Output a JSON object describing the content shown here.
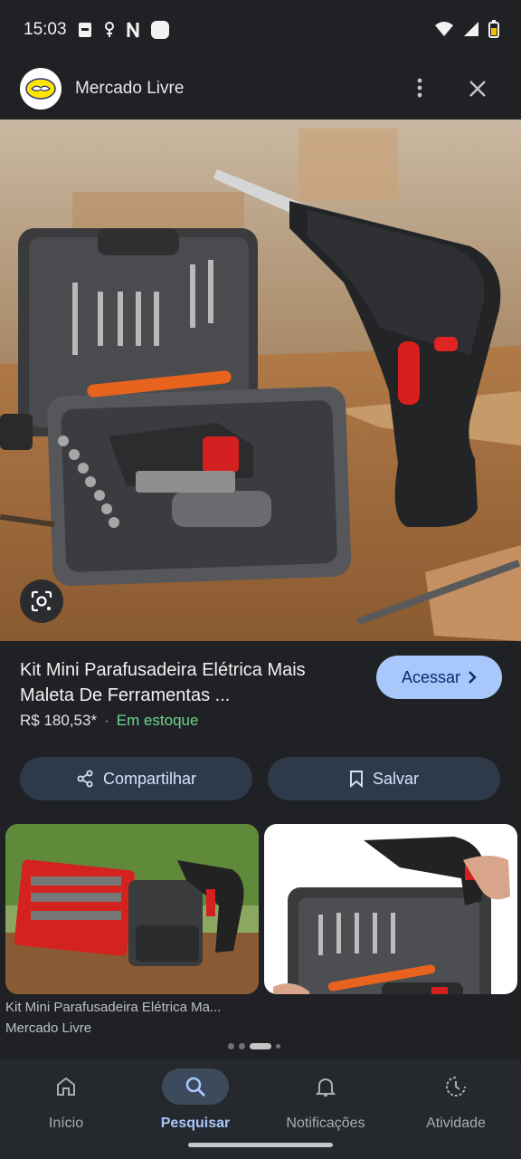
{
  "status_bar": {
    "time": "15:03"
  },
  "header": {
    "site_name": "Mercado Livre"
  },
  "product": {
    "title_line1": "Kit Mini Parafusadeira Elétrica Mais",
    "title_line2": "Maleta De Ferramentas ...",
    "price": "R$ 180,53*",
    "separator": "·",
    "stock": "Em estoque",
    "access_label": "Acessar"
  },
  "actions": {
    "share_label": "Compartilhar",
    "save_label": "Salvar"
  },
  "related": [
    {
      "title": "Kit Mini Parafusadeira Elétrica Ma...",
      "source": "Mercado Livre"
    },
    {
      "title": "",
      "source": ""
    }
  ],
  "bottom_nav": {
    "items": [
      {
        "label": "Início",
        "icon": "home-icon"
      },
      {
        "label": "Pesquisar",
        "icon": "search-icon"
      },
      {
        "label": "Notificações",
        "icon": "bell-icon"
      },
      {
        "label": "Atividade",
        "icon": "activity-icon"
      }
    ],
    "active": "Pesquisar"
  },
  "colors": {
    "accent": "#a8c7fa",
    "stock_green": "#6dd58c",
    "background": "#1f2125"
  }
}
